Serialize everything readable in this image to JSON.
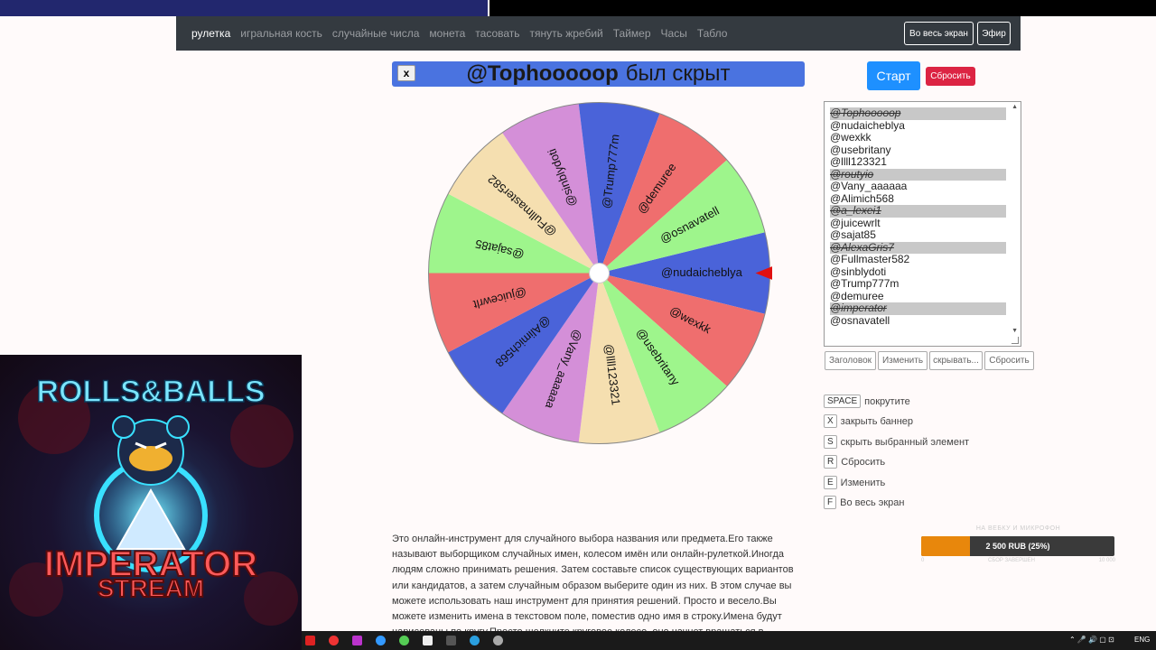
{
  "nav": {
    "items": [
      "рулетка",
      "игральная кость",
      "случайные числа",
      "монета",
      "тасовать",
      "тянуть жребий",
      "Таймер",
      "Часы",
      "Табло"
    ],
    "fullscreen": "Во весь экран",
    "live": "Эфир"
  },
  "banner": {
    "close": "x",
    "name": "@Tophooooop",
    "suffix": "был скрыт",
    "color": "#4a73e0"
  },
  "wheel": {
    "segments": [
      {
        "label": "@nudaicheblya",
        "color": "#4a63d9"
      },
      {
        "label": "@wexkk",
        "color": "#ef6e6e"
      },
      {
        "label": "@usebritany",
        "color": "#9ef58c"
      },
      {
        "label": "@llll123321",
        "color": "#f5dfb0"
      },
      {
        "label": "@Vany_aaaaaa",
        "color": "#d48fd8"
      },
      {
        "label": "@Alimich568",
        "color": "#4a63d9"
      },
      {
        "label": "@juicewrlt",
        "color": "#ef6e6e"
      },
      {
        "label": "@sajat85",
        "color": "#9ef58c"
      },
      {
        "label": "@Fullmaster582",
        "color": "#f5dfb0"
      },
      {
        "label": "@sinblydoti",
        "color": "#d48fd8"
      },
      {
        "label": "@Trump777m",
        "color": "#4a63d9"
      },
      {
        "label": "@demuree",
        "color": "#ef6e6e"
      },
      {
        "label": "@osnavatell",
        "color": "#9ef58c"
      }
    ],
    "pointer_color": "#e01010"
  },
  "controls": {
    "start": "Старт",
    "reset": "Сбросить"
  },
  "names": [
    {
      "text": "@Tophooooop",
      "hidden": true
    },
    {
      "text": "@nudaicheblya",
      "hidden": false
    },
    {
      "text": "@wexkk",
      "hidden": false
    },
    {
      "text": "@usebritany",
      "hidden": false
    },
    {
      "text": "@llll123321",
      "hidden": false
    },
    {
      "text": "@routyio",
      "hidden": true
    },
    {
      "text": "@Vany_aaaaaa",
      "hidden": false
    },
    {
      "text": "@Alimich568",
      "hidden": false
    },
    {
      "text": "@a_lexei1",
      "hidden": true
    },
    {
      "text": "@juicewrlt",
      "hidden": false
    },
    {
      "text": "@sajat85",
      "hidden": false
    },
    {
      "text": "@AlexaGris7",
      "hidden": true
    },
    {
      "text": "@Fullmaster582",
      "hidden": false
    },
    {
      "text": "@sinblydoti",
      "hidden": false
    },
    {
      "text": "@Trump777m",
      "hidden": false
    },
    {
      "text": "@demuree",
      "hidden": false
    },
    {
      "text": "@imperator",
      "hidden": true
    },
    {
      "text": "@osnavatell",
      "hidden": false
    }
  ],
  "list_buttons": [
    "Заголовок",
    "Изменить",
    "скрывать...",
    "Сбросить"
  ],
  "shortcuts": [
    {
      "key": "SPACE",
      "label": "покрутите"
    },
    {
      "key": "X",
      "label": "закрыть баннер"
    },
    {
      "key": "S",
      "label": "скрыть выбранный элемент"
    },
    {
      "key": "R",
      "label": "Сбросить"
    },
    {
      "key": "E",
      "label": "Изменить"
    },
    {
      "key": "F",
      "label": "Во весь экран"
    }
  ],
  "description": "Это онлайн-инструмент для случайного выбора названия или предмета.Его также называют выборщиком случайных имен, колесом имён или онлайн-рулеткой.Иногда людям сложно принимать решения. Затем составьте список существующих вариантов или кандидатов, а затем случайным образом выберите один из них. В этом случае вы можете использовать наш инструмент для принятия решений. Просто и весело.Вы можете изменить имена в текстовом поле, поместив одно имя в строку.Имена будут нарисованы по кругу.Просто щелкните круговое колесо, оно начнет вращаться в",
  "donation": {
    "title": "НА ВЕБКУ И МИКРОФОН",
    "amount": "2 500 RUB (25%)",
    "progress": 0.25,
    "min": "0",
    "status": "СБОР ЗАВЕРШЕН",
    "max": "10 000"
  },
  "taskbar": {
    "lang": "ENG"
  },
  "stream": {
    "title": "ROLLS&BALLS",
    "line1": "IMPERATOR",
    "line2": "STREAM"
  }
}
